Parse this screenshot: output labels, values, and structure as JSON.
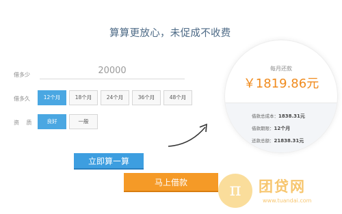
{
  "headline": "算算更放心，未促成不收费",
  "loan": {
    "amount_label": "借多少",
    "amount_value": "20000",
    "term_label": "借多久",
    "terms": [
      "12个月",
      "18个月",
      "24个月",
      "36个月",
      "48个月"
    ],
    "selected_term": "12个月",
    "quality_label": "资 质",
    "qualities": [
      "良好",
      "一般"
    ],
    "selected_quality": "良好"
  },
  "actions": {
    "calculate": "立即算一算",
    "borrow": "马上借款"
  },
  "result": {
    "monthly_label": "每月还款",
    "monthly_value": "￥1819.86元",
    "details": [
      {
        "label": "借款总成本：",
        "value": "1838.31元"
      },
      {
        "label": "借款期限：",
        "value": "12个月"
      },
      {
        "label": "还款总额：",
        "value": "21838.31元"
      }
    ]
  },
  "watermark": {
    "symbol": "π",
    "name": "团贷网",
    "url": "www.tuandai.com"
  },
  "colors": {
    "accent_blue": "#4aa7e2",
    "accent_orange": "#f59a27",
    "headline": "#4d6a86",
    "result_orange": "#f08a1c"
  }
}
